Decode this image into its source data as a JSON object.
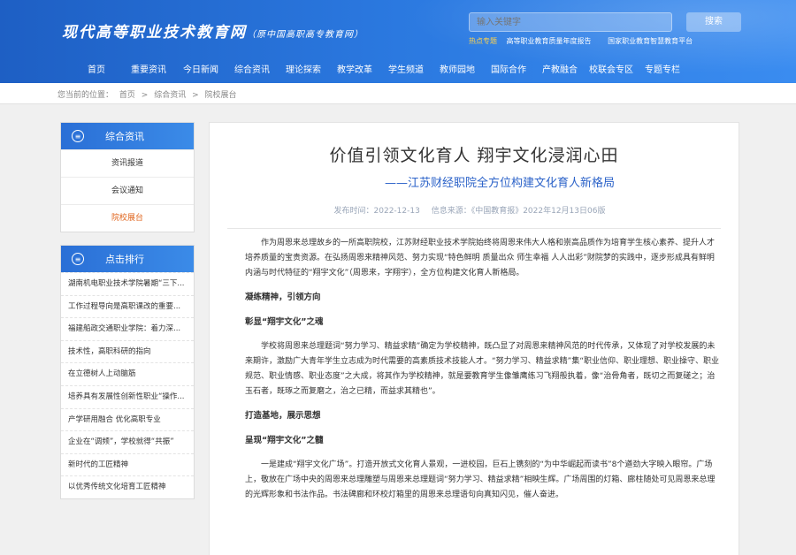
{
  "header": {
    "site_title": "现代高等职业技术教育网",
    "site_subtitle": "（原中国高职高专教育网）",
    "search_placeholder": "输入关键字",
    "search_button": "搜索",
    "hot_label": "热点专题",
    "hot_links": [
      "高等职业教育质量年度报告",
      "国家职业教育智慧教育平台"
    ]
  },
  "nav": [
    "首页",
    "重要资讯",
    "今日新闻",
    "综合资讯",
    "理论探索",
    "教学改革",
    "学生频道",
    "教师园地",
    "国际合作",
    "产教融合",
    "校联会专区",
    "专题专栏"
  ],
  "breadcrumb": {
    "prefix": "您当前的位置：",
    "items": [
      "首页",
      "综合资讯",
      "院校展台"
    ],
    "sep": ">"
  },
  "sidebar": {
    "section_title": "综合资讯",
    "menu": [
      "资讯报道",
      "会议通知",
      "院校展台"
    ],
    "active_index": 2,
    "rank_title": "点击排行",
    "rank_items": [
      "湖南机电职业技术学院暑期“三下...",
      "工作过程导向是高职课改的重要...",
      "福建船政交通职业学院：着力深...",
      "技术性，高职科研的指向",
      "在立德树人上动脑筋",
      "培养具有发展性创新性职业“操作...",
      "产学研用融合 优化高职专业",
      "企业在“调频”，学校就得“共振”",
      "新时代的工匠精神",
      "以优秀传统文化培育工匠精神"
    ]
  },
  "article": {
    "title": "价值引领文化育人 翔宇文化浸润心田",
    "subtitle": "——江苏财经职院全方位构建文化育人新格局",
    "publish_time": "发布时间：2022-12-13",
    "source": "信息来源：《中国教育报》2022年12月13日06版",
    "paragraphs": [
      {
        "type": "p",
        "text": "作为周恩来总理故乡的一所高职院校，江苏财经职业技术学院始终将周恩来伟大人格和崇高品质作为培育学生核心素养、提升人才培养质量的宝贵资源。在弘扬周恩来精神风范、努力实现“特色鲜明 质量出众 师生幸福 人人出彩”财院梦的实践中，逐步形成具有鲜明内涵与时代特征的“翔宇文化”（周恩来，字翔宇），全方位构建文化育人新格局。"
      },
      {
        "type": "h",
        "text": "凝练精神，引领方向"
      },
      {
        "type": "h",
        "text": "彰显“翔宇文化”之魂"
      },
      {
        "type": "p",
        "text": "学校将周恩来总理题词“努力学习、精益求精”确定为学校精神，既凸显了对周恩来精神风范的时代传承，又体现了对学校发展的未来期许，激励广大青年学生立志成为时代需要的高素质技术技能人才。“努力学习、精益求精”集“职业信仰、职业理想、职业操守、职业规范、职业情感、职业态度”之大成，将其作为学校精神，就是要教育学生像雏鹰练习飞翔般执着，像“治骨角者，既切之而复磋之；治玉石者，既琢之而复磨之，治之已精，而益求其精也”。"
      },
      {
        "type": "h",
        "text": "打造基地，展示思想"
      },
      {
        "type": "h",
        "text": "呈现“翔宇文化”之髓"
      },
      {
        "type": "p",
        "text": "一是建成“翔宇文化广场”。打造开放式文化育人景观，一进校园，巨石上镌刻的“为中华崛起而读书”8个遒劲大字映入眼帘。广场上，敬放在广场中央的周恩来总理雕塑与周恩来总理题词“努力学习、精益求精”相映生辉。广场周围的灯箱、廊柱随处可见周恩来总理的光辉形象和书法作品。书法碑廊和环校灯箱里的周恩来总理语句向真知闪见，催人奋进。"
      }
    ]
  },
  "colors": {
    "header_blue": "#2b79e0",
    "panel_blue": "#2a6fd6",
    "subtitle_blue": "#2c63c9",
    "active_orange": "#e0661f",
    "hot_yellow": "#ffd34d"
  }
}
